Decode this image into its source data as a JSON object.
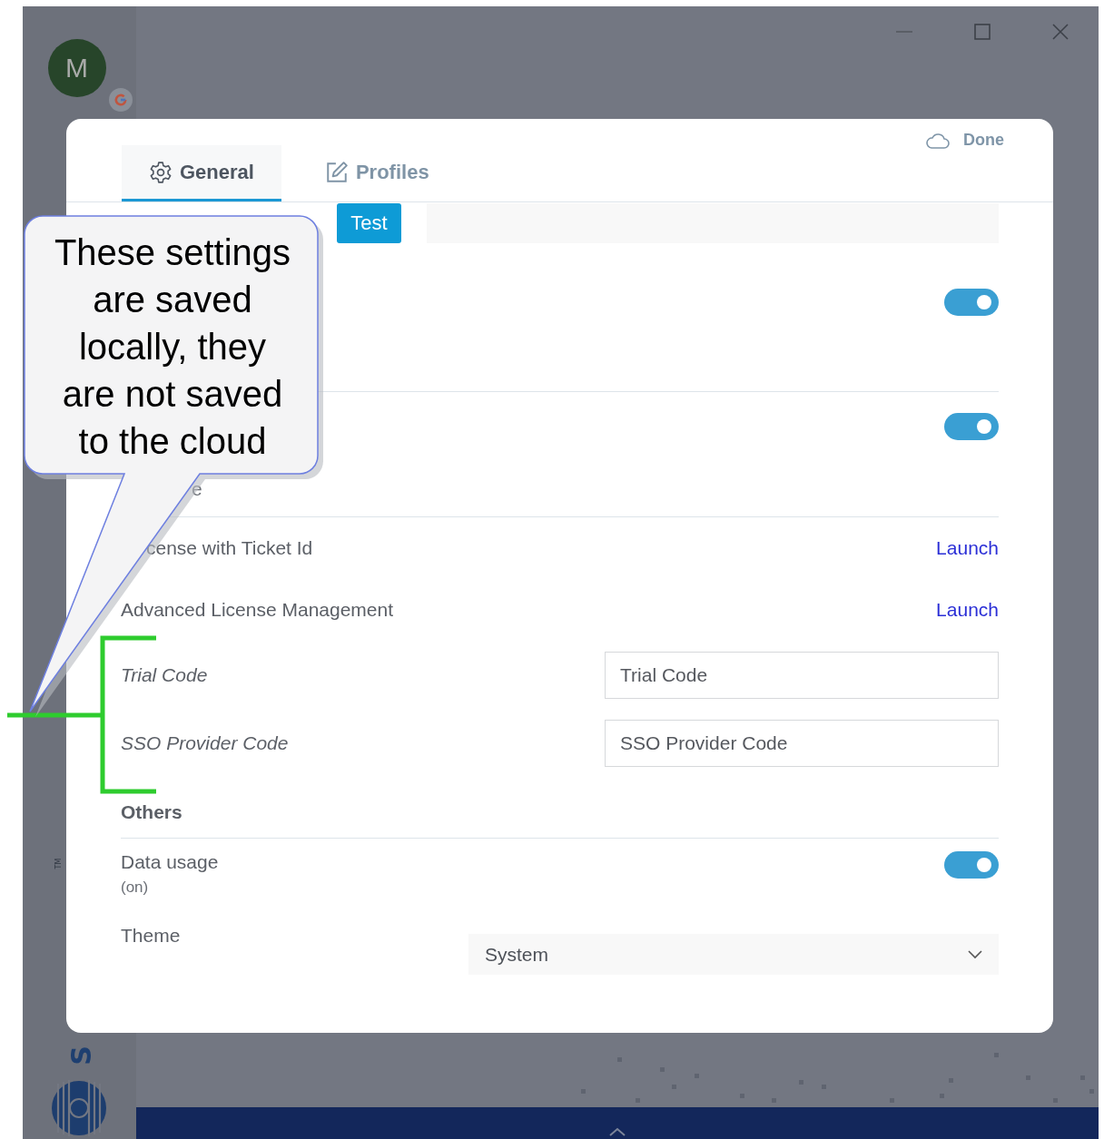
{
  "account": {
    "initial": "M"
  },
  "sidebar": {
    "trademark": "TM",
    "logo_fragment": "S"
  },
  "dialog": {
    "tabs": [
      {
        "label": "General",
        "selected": true
      },
      {
        "label": "Profiles",
        "selected": false
      }
    ],
    "done_button": "Done",
    "rows": [
      {
        "kind": "test",
        "button": "Test"
      },
      {
        "kind": "toggle",
        "on": true,
        "divider_after": true
      },
      {
        "kind": "toggle",
        "on": true,
        "note": "e",
        "divider_after": true
      },
      {
        "kind": "link",
        "label": "cense with Ticket Id",
        "link": "Launch"
      },
      {
        "kind": "link",
        "label": "Advanced License Management",
        "link": "Launch"
      },
      {
        "kind": "input",
        "label": "Trial Code",
        "placeholder": "Trial Code"
      },
      {
        "kind": "input",
        "label": "SSO Provider Code",
        "placeholder": "SSO Provider Code"
      },
      {
        "kind": "heading",
        "label": "Others"
      },
      {
        "kind": "toggle",
        "label": "Data usage",
        "note": "(on)",
        "on": true
      },
      {
        "kind": "select",
        "label": "Theme",
        "value": "System"
      }
    ]
  },
  "callout": {
    "text": "These settings are saved locally, they are not saved to the cloud"
  }
}
